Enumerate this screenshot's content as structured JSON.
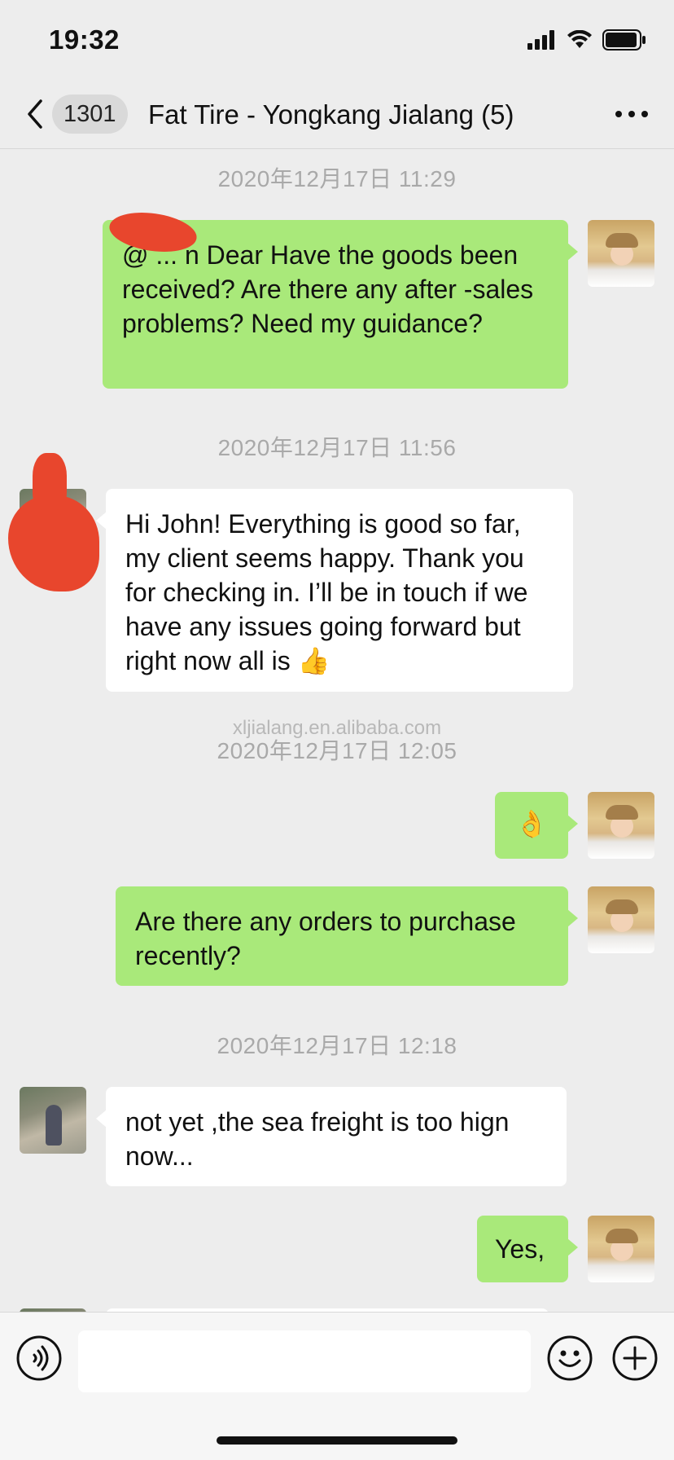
{
  "status_bar": {
    "time": "19:32",
    "icons": [
      "cellular-signal-icon",
      "wifi-icon",
      "battery-icon"
    ]
  },
  "nav": {
    "back_icon": "chevron-left-icon",
    "unread_count": "1301",
    "title": "Fat Tire - Yongkang Jialang (5)",
    "more_icon": "more-dots-icon"
  },
  "watermark": "xljialang.en.alibaba.com",
  "messages": [
    {
      "type": "timestamp",
      "text": "2020年12月17日 11:29"
    },
    {
      "type": "outgoing",
      "text": "@ ... n  Dear Have the goods been received? Are there any after -sales problems? Need my guidance?"
    },
    {
      "type": "timestamp",
      "text": "2020年12月17日 11:56"
    },
    {
      "type": "incoming",
      "text": "Hi John! Everything is good so far, my client seems happy. Thank you for checking in. I’ll be in touch if we have any issues going forward but right now all is 👍"
    },
    {
      "type": "timestamp",
      "text": "2020年12月17日 12:05"
    },
    {
      "type": "outgoing",
      "text": "👌"
    },
    {
      "type": "outgoing",
      "text": "Are there any orders to purchase recently?"
    },
    {
      "type": "timestamp",
      "text": "2020年12月17日 12:18"
    },
    {
      "type": "incoming",
      "text": "not yet ,the sea freight is too hign now..."
    },
    {
      "type": "outgoing",
      "text": "Yes,"
    }
  ],
  "input_bar": {
    "voice_icon": "voice-icon",
    "input_value": "",
    "emoji_icon": "emoji-icon",
    "plus_icon": "plus-icon"
  },
  "colors": {
    "outgoing_bubble": "#a9e97a",
    "incoming_bubble": "#ffffff",
    "background": "#ededed",
    "timestamp_text": "#a9a9a9",
    "redaction": "#e8462d"
  }
}
